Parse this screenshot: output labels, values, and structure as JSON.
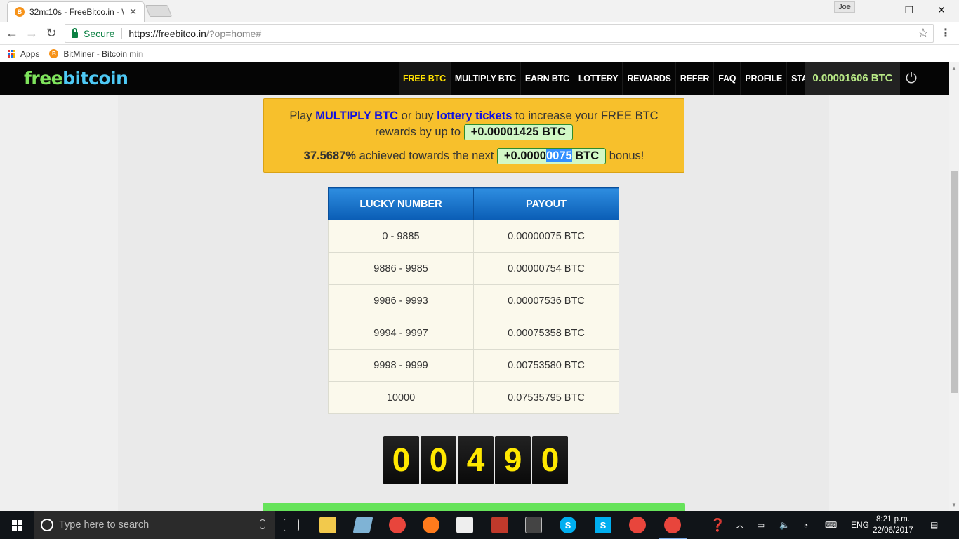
{
  "browser": {
    "tab_title": "32m:10s - FreeBitco.in - \\",
    "tab_favicon": "B",
    "profile_name": "Joe",
    "secure_label": "Secure",
    "url_host": "https://freebitco.in",
    "url_rest": "/?op=home#",
    "bookmarks": [
      {
        "label": "Apps",
        "icon": "apps-grid-icon"
      },
      {
        "label": "BitMiner - Bitcoin min",
        "icon": "bitcoin-icon"
      }
    ]
  },
  "site": {
    "logo_free": "free",
    "logo_bitcoin": "bitcoin",
    "nav": [
      "FREE BTC",
      "MULTIPLY BTC",
      "EARN BTC",
      "LOTTERY",
      "REWARDS",
      "REFER",
      "FAQ",
      "PROFILE",
      "STATS"
    ],
    "active_nav": "FREE BTC",
    "balance": "0.00001606 BTC"
  },
  "promo": {
    "play": "Play",
    "multiply_link": "MULTIPLY BTC",
    "or_buy": "or buy",
    "lottery_link": "lottery tickets",
    "increase": "to increase your FREE BTC",
    "rewards_by": "rewards by up to",
    "bonus_amount": "+0.00001425 BTC",
    "achieved_pct": "37.5687%",
    "achieved_text": "achieved towards the next",
    "next_prefix": "+0.0000",
    "next_selected": "0075",
    "next_suffix": " BTC",
    "bonus_word": "bonus!"
  },
  "lucky_table": {
    "headers": [
      "LUCKY NUMBER",
      "PAYOUT"
    ],
    "rows": [
      [
        "0 - 9885",
        "0.00000075 BTC"
      ],
      [
        "9886 - 9985",
        "0.00000754 BTC"
      ],
      [
        "9986 - 9993",
        "0.00007536 BTC"
      ],
      [
        "9994 - 9997",
        "0.00075358 BTC"
      ],
      [
        "9998 - 9999",
        "0.00753580 BTC"
      ],
      [
        "10000",
        "0.07535795 BTC"
      ]
    ]
  },
  "roll_digits": [
    "0",
    "0",
    "4",
    "9",
    "0"
  ],
  "taskbar": {
    "search_placeholder": "Type here to search",
    "language": "ENG",
    "time": "8:21 p.m.",
    "date": "22/06/2017"
  }
}
